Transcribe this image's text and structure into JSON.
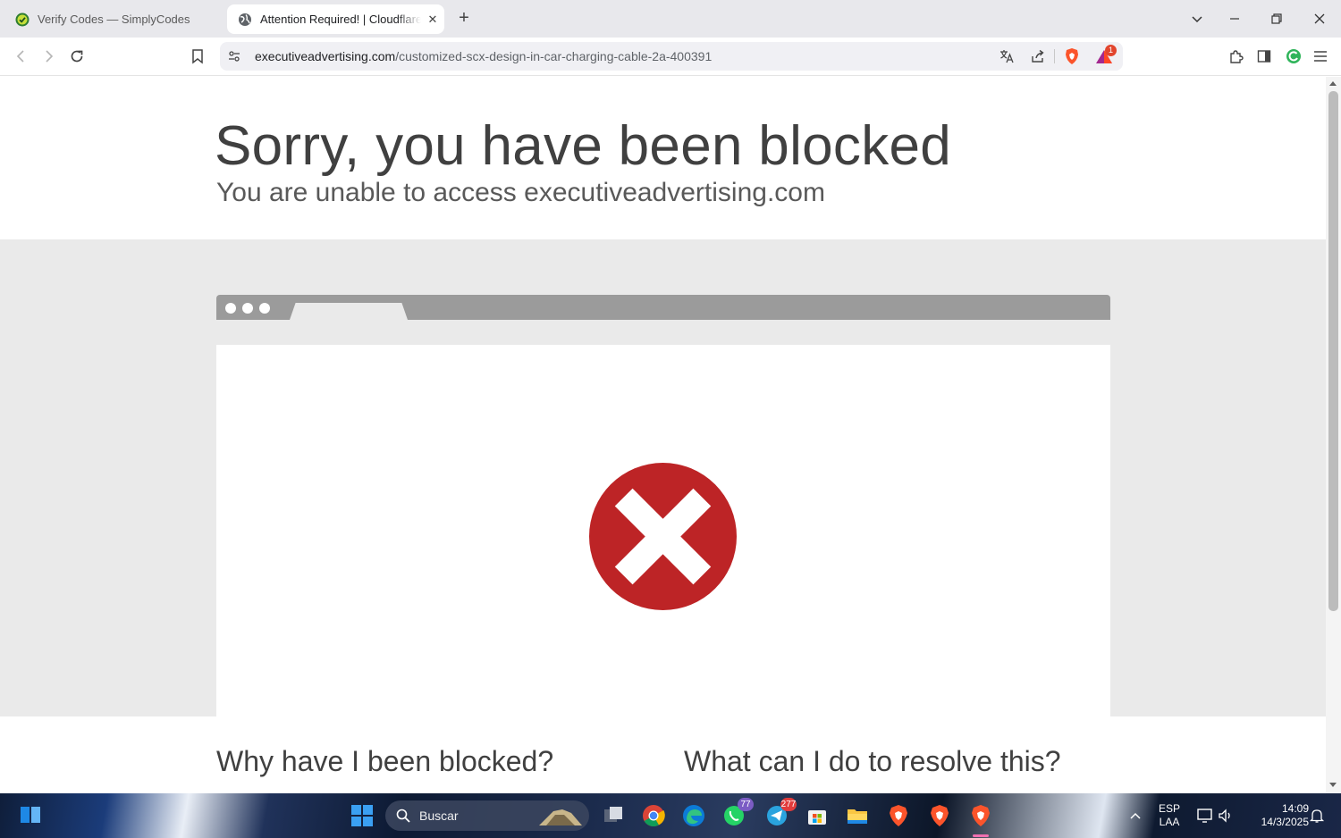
{
  "browser": {
    "tabs": [
      {
        "title": "Verify Codes — SimplyCodes",
        "favicon": "simplycodes-icon",
        "active": false
      },
      {
        "title": "Attention Required! | Cloudflare",
        "favicon": "globe-icon",
        "active": true
      }
    ],
    "new_tab_label": "+",
    "address": {
      "domain": "executiveadvertising.com",
      "path": "/customized-scx-design-in-car-charging-cable-2a-400391"
    },
    "brave_rewards_count": "1"
  },
  "page": {
    "heading": "Sorry, you have been blocked",
    "subheading": "You are unable to access executiveadvertising.com",
    "why_blocked_heading": "Why have I been blocked?",
    "resolve_heading": "What can I do to resolve this?",
    "colors": {
      "error_red": "#bd2426",
      "frame_gray": "#9b9b9b",
      "band_gray": "#eaeaea",
      "heading_text": "#404040"
    }
  },
  "taskbar": {
    "search_placeholder": "Buscar",
    "whatsapp_badge": "77",
    "telegram_badge": "277",
    "language_line1": "ESP",
    "language_line2": "LAA",
    "time": "14:09",
    "date": "14/3/2025"
  }
}
